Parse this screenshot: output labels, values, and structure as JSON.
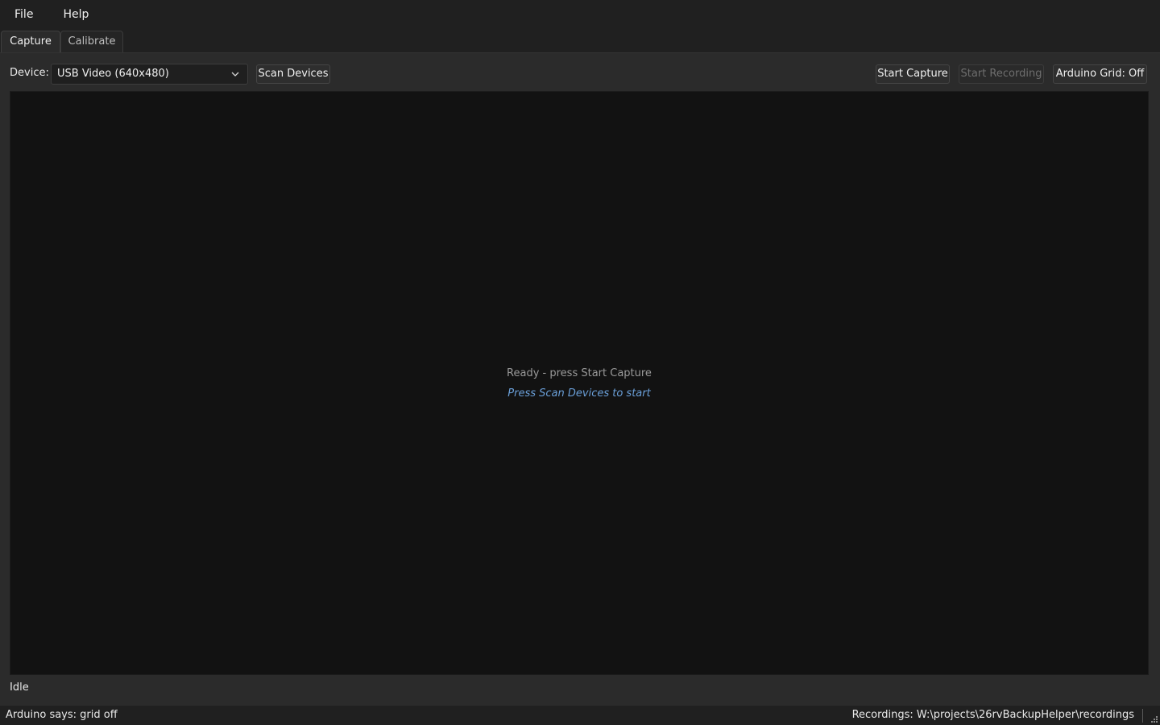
{
  "menu": {
    "items": [
      "File",
      "Help"
    ]
  },
  "tabs": [
    {
      "label": "Capture",
      "active": true
    },
    {
      "label": "Calibrate",
      "active": false
    }
  ],
  "toolbar": {
    "device_label": "Device:",
    "device_selected": "USB Video (640x480)",
    "scan_devices": "Scan Devices",
    "start_capture": "Start Capture",
    "start_recording": "Start Recording",
    "arduino_grid": "Arduino Grid: Off"
  },
  "viewport": {
    "message": "Ready - press Start Capture",
    "hint": "Press Scan Devices to start"
  },
  "capture_status": "Idle",
  "statusbar": {
    "left": "Arduino says: grid off",
    "right": "Recordings: W:\\projects\\26rvBackupHelper\\recordings"
  },
  "colors": {
    "window_bg": "#202020",
    "panel_bg": "#2b2b2b",
    "viewport_bg": "#121212",
    "hint_text": "#6a9fd8",
    "disabled_text": "#6e6e6e"
  },
  "icons": {
    "combo_arrow": "chevron-down-icon",
    "size_grip": "resize-grip-icon"
  }
}
